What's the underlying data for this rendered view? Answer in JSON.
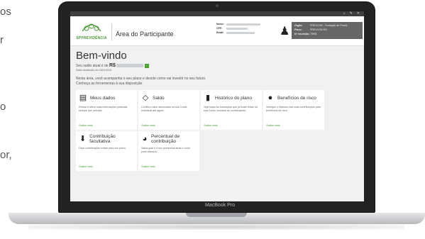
{
  "edge_text": [
    "os",
    "r",
    "o",
    "or,"
  ],
  "laptop": {
    "brand": "MacBook Pro"
  },
  "topbar": {
    "icons": [
      "home-icon",
      "wrench-icon",
      "close-icon"
    ],
    "glyphs": [
      "⌂",
      "✎",
      "✕"
    ]
  },
  "header": {
    "logo_text": "SPPREVIDÊNCIA",
    "area_title": "Área do Participante",
    "user_fields": [
      {
        "label": "Nome:"
      },
      {
        "label": "CPF:"
      },
      {
        "label": "Email:"
      }
    ],
    "org_fields": [
      {
        "label": "Órgão:",
        "value": "PREVCOM - Fundação de Previd..."
      },
      {
        "label": "Plano:",
        "value": "PREVCOM RG"
      },
      {
        "label": "Nº Inscrição:",
        "value": "75991"
      }
    ]
  },
  "main": {
    "welcome": "Bem-vindo",
    "balance_prefix": "Seu saldo atual é de",
    "currency": "R$",
    "go_glyph": "›",
    "updated": "Saldo atualizado em 15/01/2015.",
    "intro": "Nesta área, você acompanha o seu plano e decide como vai investir no seu futuro.",
    "intro2": "Conheça as ferramentas à sua disposição"
  },
  "cards": [
    {
      "icon": "id-card-icon",
      "glyph": "▤",
      "title": "Meus dados",
      "desc": "Revise e altere suas informações pessoais sempre que precisar.",
      "link": "Saiba mais"
    },
    {
      "icon": "money-icon",
      "glyph": "◇",
      "title": "Saldo",
      "desc": "Confira o valor acumulado na sua Conta Individual até agora.",
      "link": "Saiba mais"
    },
    {
      "icon": "book-icon",
      "glyph": "▮",
      "title": "Histórico do plano",
      "desc": "Veja todas as transações que já foram feitas na sua Conta, inclusive as contribuições.",
      "link": "Saiba mais"
    },
    {
      "icon": "alert-icon",
      "glyph": "●",
      "title": "Benefícios de risco",
      "desc": "Verifique o histórico das suas contribuições para benefícios de risco.",
      "link": "Saiba mais"
    },
    {
      "icon": "download-icon",
      "glyph": "⬇",
      "title": "Contribuição facultativa",
      "desc": "Faça contribuições extras para seu plano.",
      "link": "Saiba mais"
    },
    {
      "icon": "pie-chart-icon",
      "glyph": "◕",
      "title": "Percentual de contribuição",
      "desc": "Saiba qual é o seu percentual atual e como pode alterá-lo.",
      "link": "Saiba mais"
    }
  ]
}
